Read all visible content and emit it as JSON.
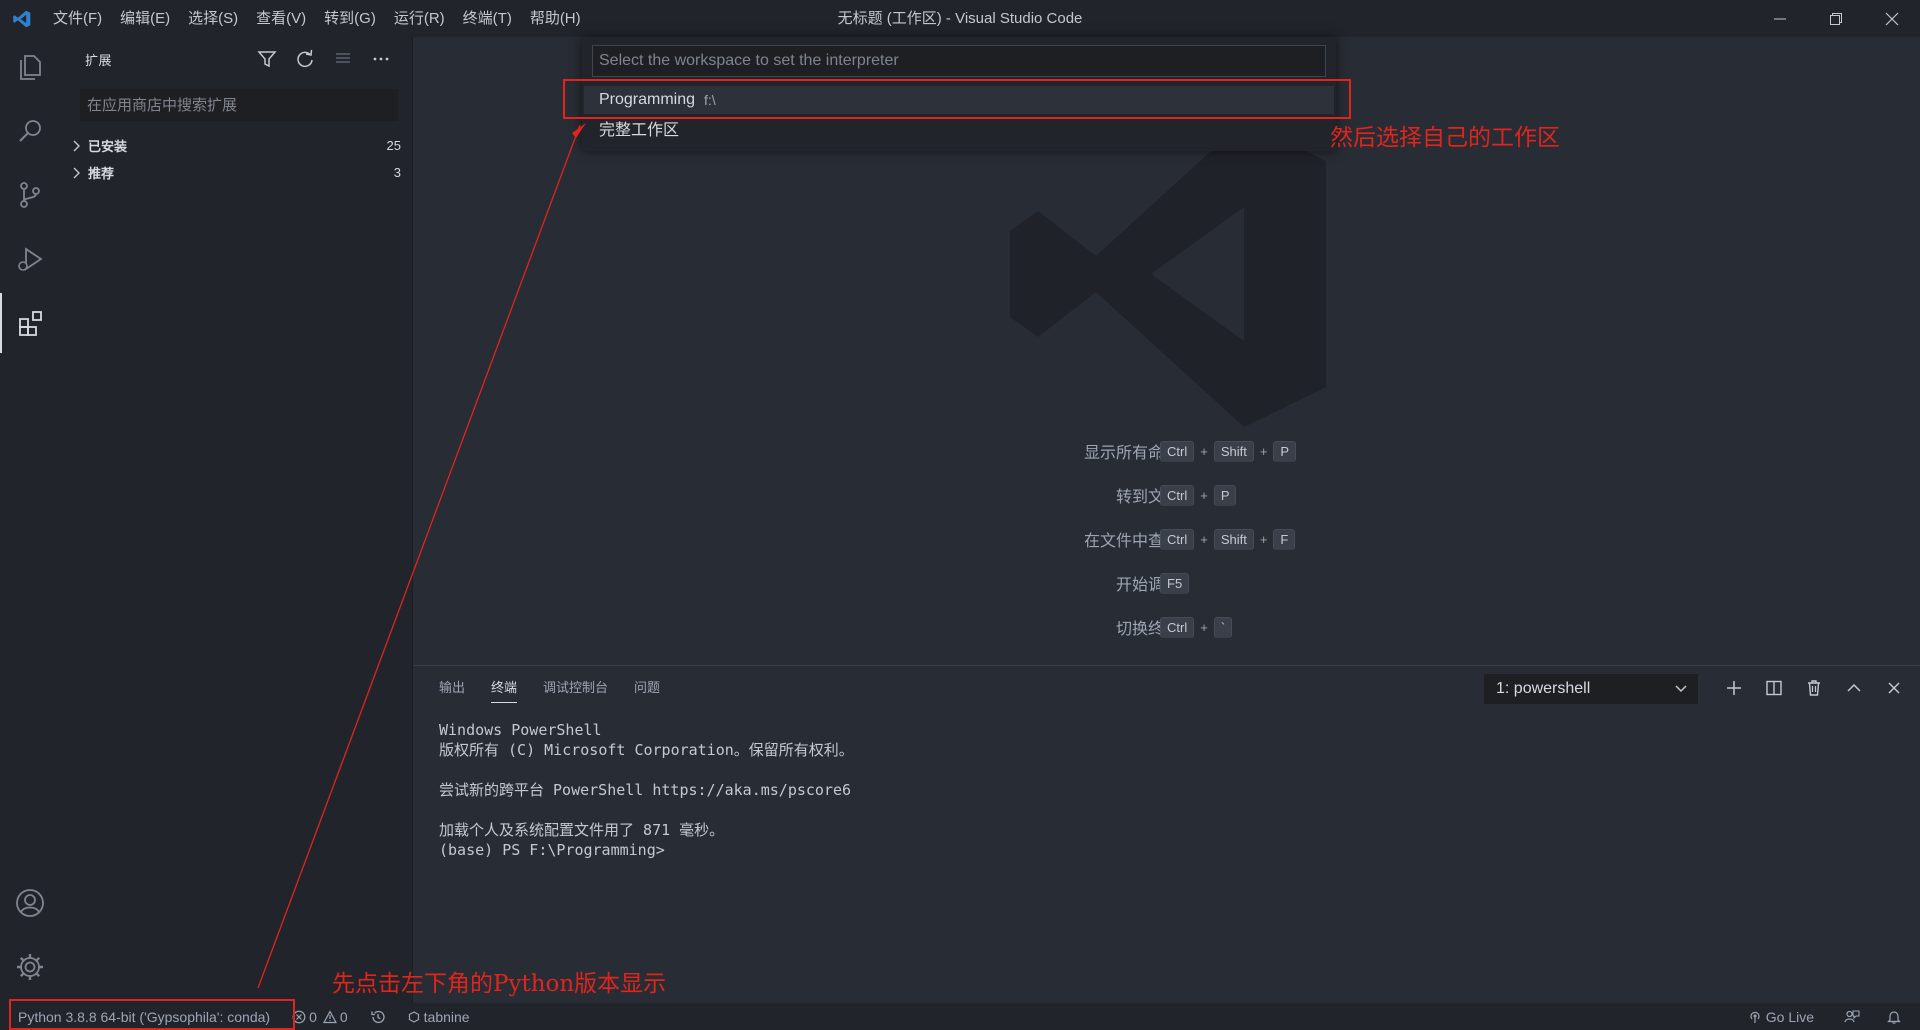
{
  "window": {
    "title": "无标题 (工作区) - Visual Studio Code"
  },
  "menu": [
    "文件(F)",
    "编辑(E)",
    "选择(S)",
    "查看(V)",
    "转到(G)",
    "运行(R)",
    "终端(T)",
    "帮助(H)"
  ],
  "sidebar": {
    "title": "扩展",
    "search_placeholder": "在应用商店中搜索扩展",
    "sections": [
      {
        "label": "已安装",
        "count": "25"
      },
      {
        "label": "推荐",
        "count": "3"
      }
    ]
  },
  "quickpick": {
    "placeholder": "Select the workspace to set the interpreter",
    "items": [
      {
        "label": "Programming",
        "description": "f:\\"
      },
      {
        "label": "完整工作区",
        "description": ""
      }
    ]
  },
  "shortcuts": [
    {
      "label": "显示所有命令",
      "keys": [
        "Ctrl",
        "Shift",
        "P"
      ]
    },
    {
      "label": "转到文件",
      "keys": [
        "Ctrl",
        "P"
      ]
    },
    {
      "label": "在文件中查找",
      "keys": [
        "Ctrl",
        "Shift",
        "F"
      ]
    },
    {
      "label": "开始调试",
      "keys": [
        "F5"
      ]
    },
    {
      "label": "切换终端",
      "keys": [
        "Ctrl",
        "`"
      ]
    }
  ],
  "panel": {
    "tabs": [
      "输出",
      "终端",
      "调试控制台",
      "问题"
    ],
    "active_tab": "终端",
    "terminal_select": "1: powershell",
    "terminal_lines": [
      "Windows PowerShell",
      "版权所有 (C) Microsoft Corporation。保留所有权利。",
      "",
      "尝试新的跨平台 PowerShell https://aka.ms/pscore6",
      "",
      "加载个人及系统配置文件用了 871 毫秒。",
      "(base) PS F:\\Programming>"
    ]
  },
  "statusbar": {
    "python": "Python 3.8.8 64-bit ('Gypsophila': conda)",
    "errors": "0",
    "warnings": "0",
    "tabnine": "tabnine",
    "golive": "Go Live"
  },
  "annotations": {
    "top": "然后选择自己的工作区",
    "bottom": "先点击左下角的Python版本显示",
    "color": "#e0251d"
  },
  "colors": {
    "background": "#282c34",
    "sidebar": "#21252b",
    "accent_vscode": "#2f80d1"
  }
}
